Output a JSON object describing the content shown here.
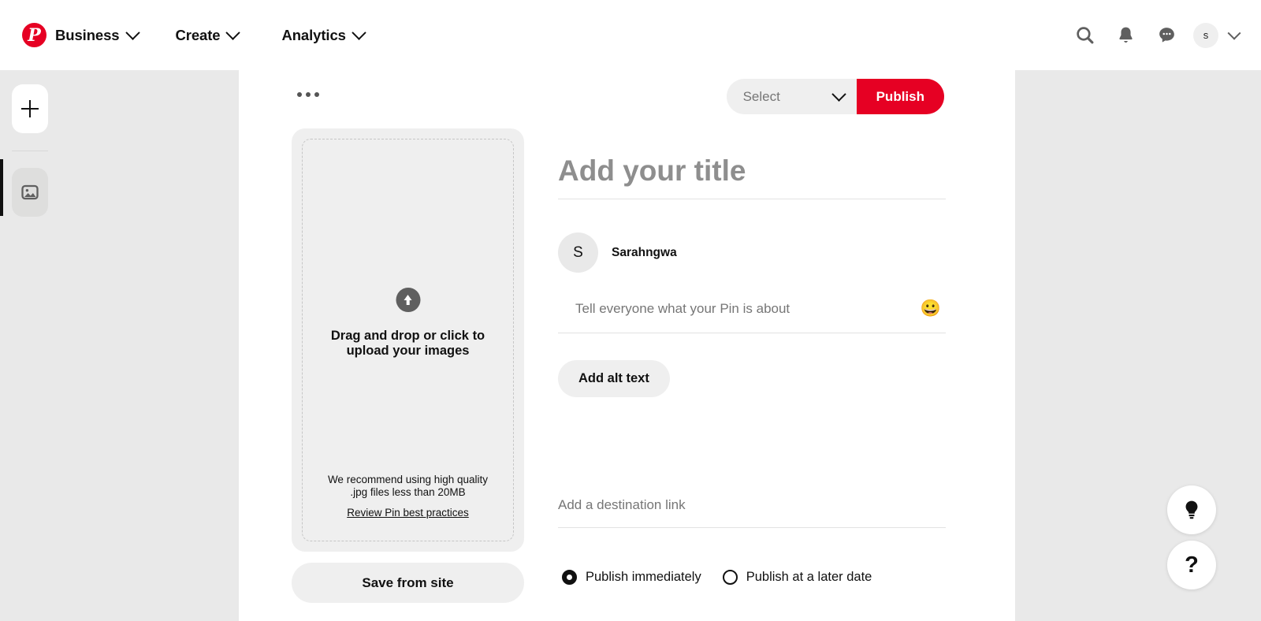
{
  "header": {
    "brand": "Business",
    "logo_icon": "pinterest-logo-icon",
    "nav": [
      {
        "label": "Create",
        "icon": "chevron-down-icon"
      },
      {
        "label": "Analytics",
        "icon": "chevron-down-icon"
      }
    ],
    "icons": {
      "search": "search-icon",
      "notifications": "bell-icon",
      "messages": "chat-bubble-icon",
      "account_chevron": "chevron-down-icon"
    },
    "avatar_initial": "s"
  },
  "rail": {
    "create_icon": "plus-icon",
    "media_icon": "image-icon"
  },
  "panel": {
    "more_options_icon": "ellipsis-icon",
    "board_select": {
      "value": "Select",
      "chevron_icon": "chevron-down-icon"
    },
    "publish_label": "Publish"
  },
  "upload": {
    "icon": "upload-arrow-icon",
    "main_text_line1": "Drag and drop or click to",
    "main_text_line2": "upload your images",
    "note_line1": "We recommend using high quality",
    "note_line2": ".jpg files less than 20MB",
    "link": "Review Pin best practices",
    "save_from_site": "Save from site"
  },
  "form": {
    "title_placeholder": "Add your title",
    "title_value": "",
    "avatar_initial": "S",
    "profile_name": "Sarahngwa",
    "description_placeholder": "Tell everyone what your Pin is about",
    "description_value": "",
    "emoji_icon": "grinning-face-emoji",
    "alt_text_label": "Add alt text",
    "link_placeholder": "Add a destination link",
    "link_value": "",
    "publish_options": [
      {
        "label": "Publish immediately",
        "selected": true
      },
      {
        "label": "Publish at a later date",
        "selected": false
      }
    ]
  },
  "fabs": {
    "idea_icon": "lightbulb-icon",
    "help_icon": "question-mark-icon",
    "help_glyph": "?"
  },
  "colors": {
    "brand_red": "#e60023",
    "page_bg": "#e9e9e9",
    "panel_bg": "#ffffff",
    "field_gray": "#efefef"
  }
}
